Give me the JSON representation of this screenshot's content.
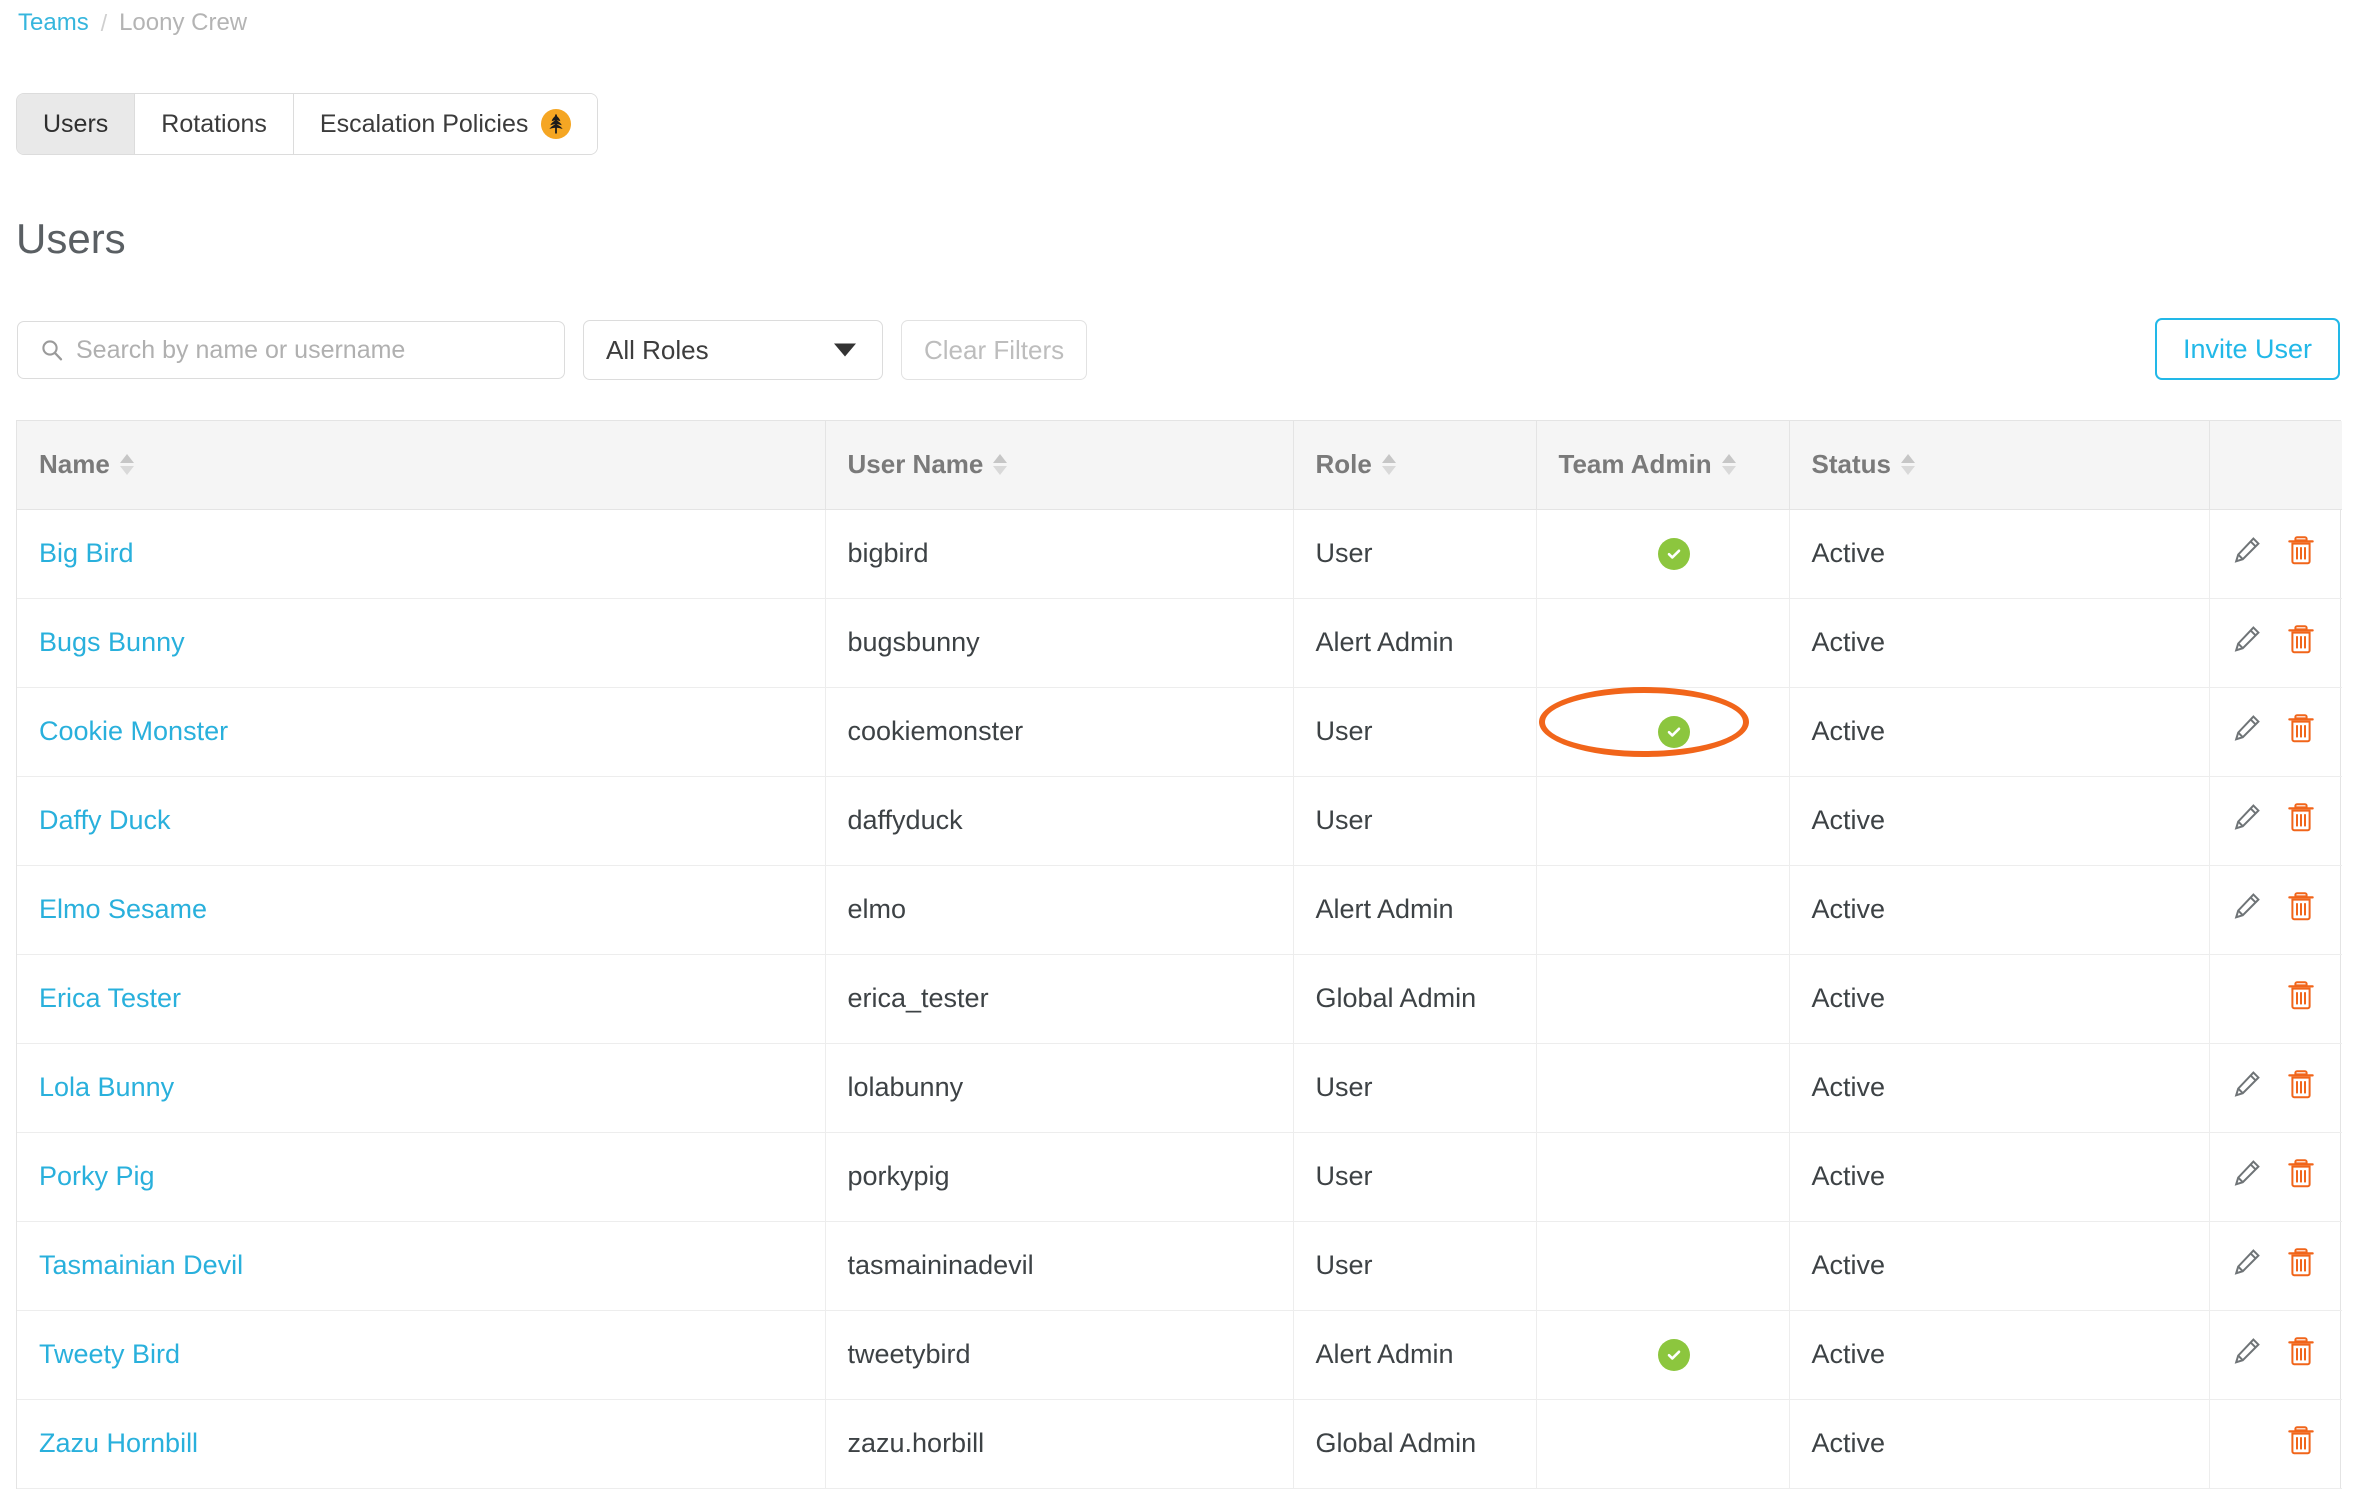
{
  "breadcrumb": {
    "root_label": "Teams",
    "separator": "/",
    "current_label": "Loony Crew"
  },
  "tabs": [
    {
      "label": "Users",
      "active": true,
      "badge": null
    },
    {
      "label": "Rotations",
      "active": false,
      "badge": null
    },
    {
      "label": "Escalation Policies",
      "active": false,
      "badge": "leaf-badge-icon"
    }
  ],
  "page_title": "Users",
  "filters": {
    "search_placeholder": "Search by name or username",
    "search_value": "",
    "role_select_value": "All Roles",
    "clear_filters_label": "Clear Filters"
  },
  "invite_button_label": "Invite User",
  "table": {
    "columns": [
      {
        "key": "name",
        "label": "Name",
        "sortable": true
      },
      {
        "key": "username",
        "label": "User Name",
        "sortable": true
      },
      {
        "key": "role",
        "label": "Role",
        "sortable": true
      },
      {
        "key": "team_admin",
        "label": "Team Admin",
        "sortable": true
      },
      {
        "key": "status",
        "label": "Status",
        "sortable": true
      },
      {
        "key": "actions",
        "label": "",
        "sortable": false
      }
    ],
    "rows": [
      {
        "name": "Big Bird",
        "username": "bigbird",
        "role": "User",
        "team_admin": true,
        "status": "Active",
        "can_edit": true,
        "can_delete": true
      },
      {
        "name": "Bugs Bunny",
        "username": "bugsbunny",
        "role": "Alert Admin",
        "team_admin": false,
        "status": "Active",
        "can_edit": true,
        "can_delete": true
      },
      {
        "name": "Cookie Monster",
        "username": "cookiemonster",
        "role": "User",
        "team_admin": true,
        "status": "Active",
        "can_edit": true,
        "can_delete": true
      },
      {
        "name": "Daffy Duck",
        "username": "daffyduck",
        "role": "User",
        "team_admin": false,
        "status": "Active",
        "can_edit": true,
        "can_delete": true
      },
      {
        "name": "Elmo Sesame",
        "username": "elmo",
        "role": "Alert Admin",
        "team_admin": false,
        "status": "Active",
        "can_edit": true,
        "can_delete": true
      },
      {
        "name": "Erica Tester",
        "username": "erica_tester",
        "role": "Global Admin",
        "team_admin": false,
        "status": "Active",
        "can_edit": false,
        "can_delete": true
      },
      {
        "name": "Lola Bunny",
        "username": "lolabunny",
        "role": "User",
        "team_admin": false,
        "status": "Active",
        "can_edit": true,
        "can_delete": true
      },
      {
        "name": "Porky Pig",
        "username": "porkypig",
        "role": "User",
        "team_admin": false,
        "status": "Active",
        "can_edit": true,
        "can_delete": true
      },
      {
        "name": "Tasmainian Devil",
        "username": "tasmaininadevil",
        "role": "User",
        "team_admin": false,
        "status": "Active",
        "can_edit": true,
        "can_delete": true
      },
      {
        "name": "Tweety Bird",
        "username": "tweetybird",
        "role": "Alert Admin",
        "team_admin": true,
        "status": "Active",
        "can_edit": true,
        "can_delete": true
      },
      {
        "name": "Zazu Hornbill",
        "username": "zazu.horbill",
        "role": "Global Admin",
        "team_admin": false,
        "status": "Active",
        "can_edit": false,
        "can_delete": true
      }
    ]
  },
  "annotation": {
    "shape": "ellipse",
    "target": "team-admin-check-cookie-monster"
  },
  "colors": {
    "link": "#29b0dc",
    "accent": "#22b8e8",
    "check_green": "#8cc63e",
    "delete_orange": "#f1651a",
    "badge_orange": "#f5a623",
    "annotation_orange": "#f1651a"
  },
  "icons": {
    "search": "search-icon",
    "caret_down": "chevron-down-icon",
    "sort": "sort-arrows-icon",
    "check": "check-circle-icon",
    "edit": "pencil-icon",
    "delete": "trash-icon",
    "badge": "leaf-icon"
  }
}
